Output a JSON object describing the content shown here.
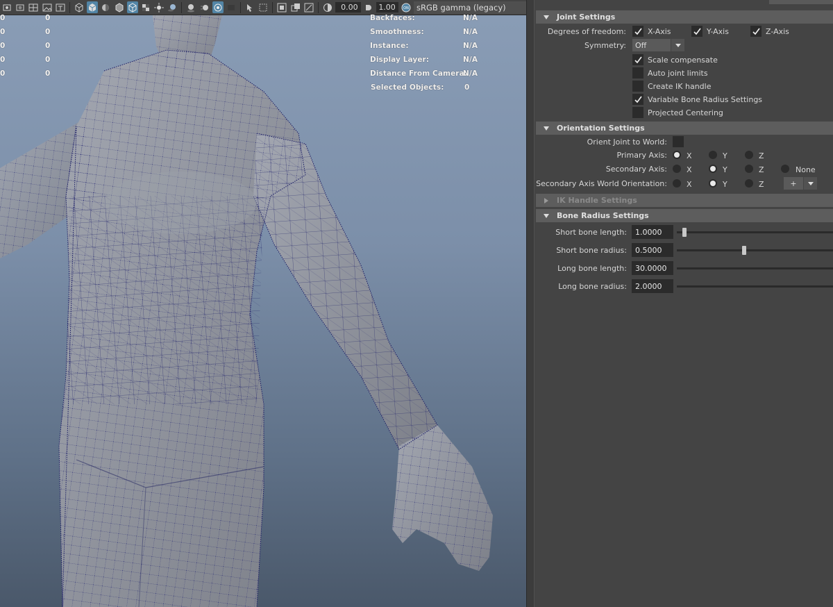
{
  "toolbar": {
    "exposure": "0.00",
    "gamma": "1.00",
    "color_space": "sRGB gamma (legacy)"
  },
  "hud": {
    "left_rows": [
      [
        "0",
        "0"
      ],
      [
        "0",
        "0"
      ],
      [
        "0",
        "0"
      ],
      [
        "0",
        "0"
      ],
      [
        "0",
        "0"
      ]
    ],
    "stats": [
      {
        "label": "Backfaces:",
        "value": "N/A"
      },
      {
        "label": "Smoothness:",
        "value": "N/A"
      },
      {
        "label": "Instance:",
        "value": "N/A"
      },
      {
        "label": "Display Layer:",
        "value": "N/A"
      },
      {
        "label": "Distance From Camera:",
        "value": "N/A"
      },
      {
        "label": "Selected Objects:",
        "value": "0"
      }
    ]
  },
  "joint_settings": {
    "title": "Joint Settings",
    "dof_label": "Degrees of freedom:",
    "dof": [
      {
        "label": "X-Axis",
        "checked": true
      },
      {
        "label": "Y-Axis",
        "checked": true
      },
      {
        "label": "Z-Axis",
        "checked": true
      }
    ],
    "symmetry_label": "Symmetry:",
    "symmetry_value": "Off",
    "options": [
      {
        "label": "Scale compensate",
        "checked": true
      },
      {
        "label": "Auto joint limits",
        "checked": false
      },
      {
        "label": "Create IK handle",
        "checked": false
      },
      {
        "label": "Variable Bone Radius Settings",
        "checked": true
      },
      {
        "label": "Projected Centering",
        "checked": false
      }
    ]
  },
  "orientation_settings": {
    "title": "Orientation Settings",
    "orient_label": "Orient Joint to World:",
    "primary_label": "Primary Axis:",
    "secondary_label": "Secondary Axis:",
    "world_label": "Secondary Axis World Orientation:",
    "x": "X",
    "y": "Y",
    "z": "Z",
    "none": "None",
    "world_dropdown": "+",
    "primary_selected": "X",
    "secondary_selected": "Y",
    "world_selected": "Y"
  },
  "ik_handle_settings": {
    "title": "IK Handle Settings"
  },
  "bone_radius_settings": {
    "title": "Bone Radius Settings",
    "fields": [
      {
        "label": "Short bone length:",
        "value": "1.0000",
        "slider": 0.05
      },
      {
        "label": "Short bone radius:",
        "value": "0.5000",
        "slider": 0.43
      },
      {
        "label": "Long bone length:",
        "value": "30.0000"
      },
      {
        "label": "Long bone radius:",
        "value": "2.0000"
      }
    ]
  },
  "colors": {
    "viewport_top": "#8a9db6",
    "viewport_bottom": "#4a586a",
    "panel_bg": "#444444",
    "header_bg": "#5d5d5d",
    "accent": "#5285a6",
    "wire": "#1d1f6e"
  }
}
